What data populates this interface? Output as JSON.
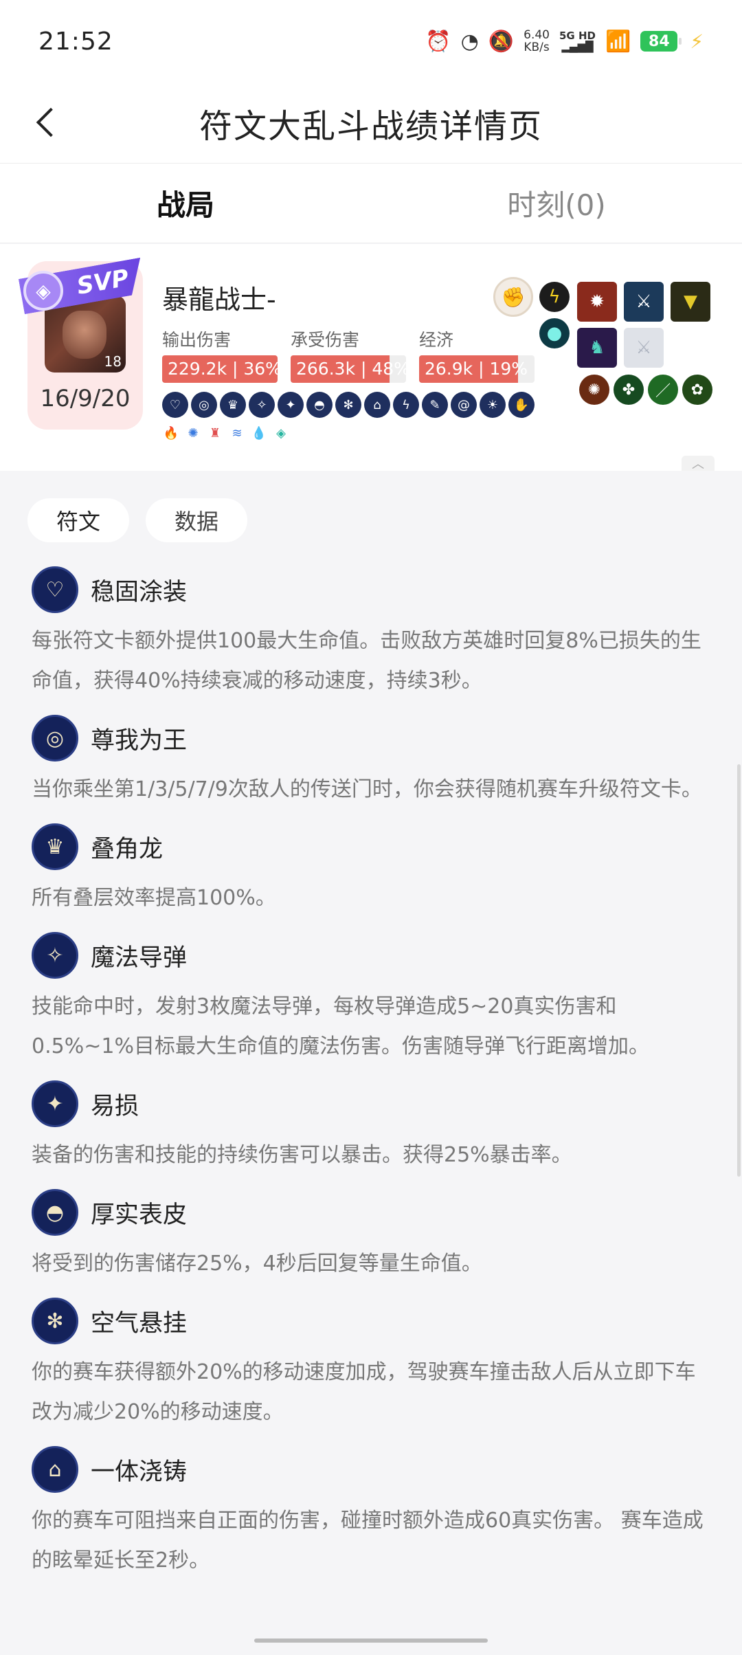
{
  "status_bar": {
    "time": "21:52",
    "speed_value": "6.40",
    "speed_unit": "KB/s",
    "network_label": "5G HD",
    "battery": "84",
    "icons": [
      "alarm-icon",
      "speed-icon",
      "mute-icon",
      "signal-icon",
      "wifi-icon",
      "battery-icon",
      "charging-icon"
    ]
  },
  "header": {
    "title": "符文大乱斗战绩详情页"
  },
  "tabs": [
    {
      "label": "战局",
      "active": true
    },
    {
      "label": "时刻(0)",
      "active": false
    }
  ],
  "player": {
    "badge": "SVP",
    "level": "18",
    "name": "暴龍战士-",
    "kda": "16/9/20",
    "stats": [
      {
        "label": "输出伤害",
        "value": "229.2k | 36%",
        "percent": 36
      },
      {
        "label": "承受伤害",
        "value": "266.3k | 48%",
        "percent": 48
      },
      {
        "label": "经济",
        "value": "26.9k | 19%",
        "percent": 19
      }
    ],
    "rune_icon_count": 13,
    "trait_icons": [
      "flame-icon",
      "swirl-icon",
      "tower-icon",
      "wave-icon",
      "drop-icon",
      "gem-icon"
    ],
    "colors": {
      "bar_fill": "#e6665c",
      "svp": "#7b5ae8",
      "card_bg": "#fde8e8"
    }
  },
  "sub_tabs": [
    {
      "label": "符文",
      "active": true
    },
    {
      "label": "数据",
      "active": false
    }
  ],
  "runes": [
    {
      "name": "稳固涂装",
      "icon": "heart-shield-icon",
      "desc": "每张符文卡额外提供100最大生命值。击败敌方英雄时回复8%已损失的生命值，获得40%持续衰减的移动速度，持续3秒。"
    },
    {
      "name": "尊我为王",
      "icon": "portal-icon",
      "desc": "当你乘坐第1/3/5/7/9次敌人的传送门时，你会获得随机赛车升级符文卡。"
    },
    {
      "name": "叠角龙",
      "icon": "horn-icon",
      "desc": "所有叠层效率提高100%。"
    },
    {
      "name": "魔法导弹",
      "icon": "missile-icon",
      "desc": "技能命中时，发射3枚魔法导弹，每枚导弹造成5~20真实伤害和0.5%~1%目标最大生命值的魔法伤害。伤害随导弹飞行距离增加。"
    },
    {
      "name": "易损",
      "icon": "crit-icon",
      "desc": "装备的伤害和技能的持续伤害可以暴击。获得25%暴击率。"
    },
    {
      "name": "厚实表皮",
      "icon": "shell-icon",
      "desc": "将受到的伤害储存25%，4秒后回复等量生命值。"
    },
    {
      "name": "空气悬挂",
      "icon": "wheel-icon",
      "desc": "你的赛车获得额外20%的移动速度加成，驾驶赛车撞击敌人后从立即下车改为减少20%的移动速度。"
    },
    {
      "name": "一体浇铸",
      "icon": "car-icon",
      "desc": "你的赛车可阻挡来自正面的伤害，碰撞时额外造成60真实伤害。 赛车造成的眩晕延长至2秒。"
    }
  ]
}
